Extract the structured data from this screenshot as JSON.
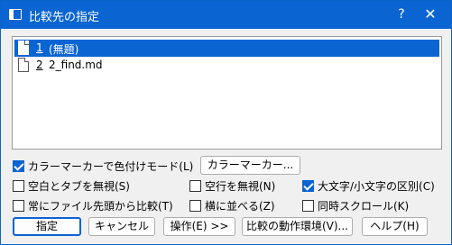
{
  "window": {
    "title": "比較先の指定",
    "help_glyph": "?",
    "close_glyph": "✕"
  },
  "file_list": {
    "items": [
      {
        "num": "1",
        "name": " (無題)",
        "selected": true
      },
      {
        "num": "2",
        "name": " 2_find.md",
        "selected": false
      }
    ]
  },
  "options": {
    "color_marker_mode": {
      "label": "カラーマーカーで色付けモード(L)",
      "checked": true
    },
    "ignore_whitespace_tab": {
      "label": "空白とタブを無視(S)",
      "checked": false
    },
    "ignore_blank_lines": {
      "label": "空行を無視(N)",
      "checked": false
    },
    "case_sensitive": {
      "label": "大文字/小文字の区別(C)",
      "checked": true
    },
    "always_compare_top": {
      "label": "常にファイル先頭から比較(T)",
      "checked": false
    },
    "side_by_side": {
      "label": "横に並べる(Z)",
      "checked": false
    },
    "sync_scroll": {
      "label": "同時スクロール(K)",
      "checked": false
    }
  },
  "buttons": {
    "color_marker": "カラーマーカー...",
    "ok": "指定",
    "cancel": "キャンセル",
    "operation": "操作(E) >>",
    "compare_env": "比較の動作環境(V)...",
    "help": "ヘルプ(H)"
  },
  "colors": {
    "accent": "#0a64d2",
    "background": "#f0f0f0"
  }
}
